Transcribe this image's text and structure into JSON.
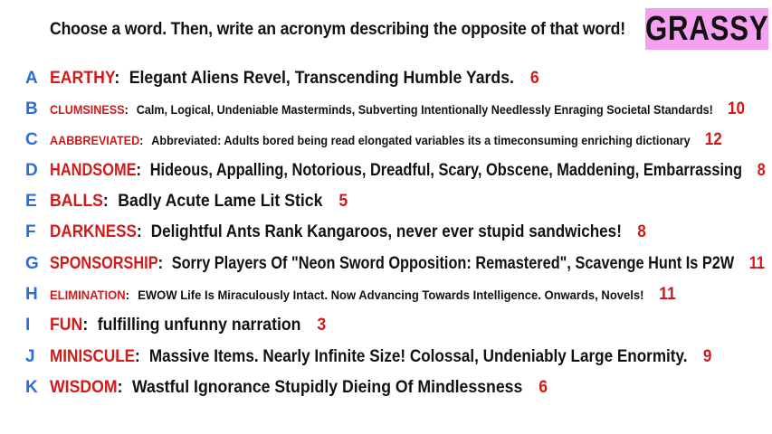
{
  "prompt": "Choose a word. Then, write an acronym describing the opposite of that word!",
  "target_word": "GRASSY",
  "colors": {
    "letter": "#2b6fd6",
    "word": "#d11a1a",
    "score": "#d11a1a",
    "badge": "#f5a0f0",
    "text": "#111111"
  },
  "entries": [
    {
      "letter": "A",
      "word": "EARTHY",
      "acronym": "Elegant Aliens Revel, Transcending Humble Yards.",
      "score": "6"
    },
    {
      "letter": "B",
      "word": "CLUMSINESS",
      "acronym": "Calm, Logical, Undeniable Masterminds, Subverting Intentionally Needlessly Enraging Societal Standards!",
      "score": "10"
    },
    {
      "letter": "C",
      "word": "AABBREVIATED",
      "acronym": "Abbreviated: Adults bored being read elongated variables its a timeconsuming enriching dictionary",
      "score": "12"
    },
    {
      "letter": "D",
      "word": "HANDSOME",
      "acronym": "Hideous, Appalling, Notorious, Dreadful, Scary, Obscene, Maddening, Embarrassing",
      "score": "8"
    },
    {
      "letter": "E",
      "word": "BALLS",
      "acronym": "Badly Acute Lame Lit Stick",
      "score": "5"
    },
    {
      "letter": "F",
      "word": "DARKNESS",
      "acronym": "Delightful Ants Rank Kangaroos, never ever stupid sandwiches!",
      "score": "8"
    },
    {
      "letter": "G",
      "word": "SPONSORSHIP",
      "acronym": "Sorry Players Of \"Neon Sword Opposition: Remastered\", Scavenge Hunt Is P2W",
      "score": "11"
    },
    {
      "letter": "H",
      "word": "ELIMINATION",
      "acronym": "EWOW Life Is Miraculously Intact. Now Advancing Towards Intelligence. Onwards, Novels!",
      "score": "11"
    },
    {
      "letter": "I",
      "word": "FUN",
      "acronym": "fulfilling unfunny narration",
      "score": "3"
    },
    {
      "letter": "J",
      "word": "MINISCULE",
      "acronym": "Massive Items. Nearly Infinite Size! Colossal, Undeniably Large Enormity.",
      "score": "9"
    },
    {
      "letter": "K",
      "word": "WISDOM",
      "acronym": "Wastful Ignorance Stupidly Dieing Of Mindlessness",
      "score": "6"
    }
  ]
}
